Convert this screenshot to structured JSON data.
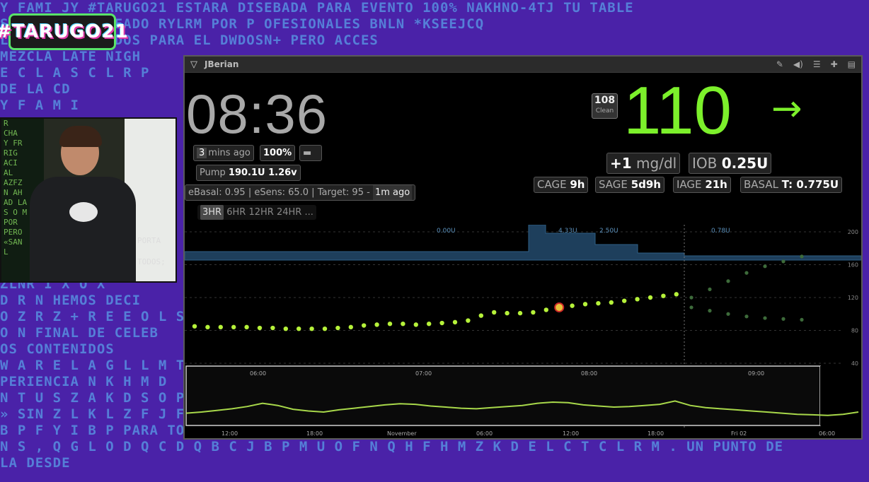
{
  "background": {
    "lines": [
      "Y FAMI   JY #TARUGO21 ESTARA DISEBADA PARA   EVENTO 100% NAKHNO-4TJ  TU TABLE",
      "         S Z X P X  RODEADO RYLRM POR P OFESIONALES BNLN  *KSEEJCQ",
      "     LOS                  ENTRETENIDOS PARA EL DWDOSN+ PERO ACCES",
      "MEZCLA  LATE NIGH",
      "       E  C L A S C L R P",
      "DE LA             CD",
      "Y F A M I",
      "",
      "",
      "",
      "",
      "",
      "",
      "",
      "",
      "",
      "",
      "ZLNR I X O X",
      "D R N  HEMOS DECI",
      "O Z R Z + R E E  O L S A",
      "O N FINAL DE CELEB",
      "OS CONTENIDOS",
      "W A R E  L A  G L L M T Y A",
      "PERIENCIA  N K H M D",
      "N T U  S Z A K D S  O P O",
      "» SIN  Z L K L Z F J F E",
      "B P F Y I B P  PARA TODOS, Y LA  B U M B O F B K  F X  MAS PARECIDA A «U  A MEZCLA B C LATE",
      "N S , Q G L  O D Q C D Q        B C J B P M U O F   N Q H F H M Z K  D E L  C T C L R M . UN PUNTO DE",
      "                               LA                                                       DESDE"
    ]
  },
  "logo": {
    "text": "#TARUGO21"
  },
  "webcam": {
    "matrix_text": "R\nCHA\nY FR\nRIG\nACI\nAL\nAZFZ\nN AH\nAD LA\nS O M\nPOR\nPERO\n«SAN\nL",
    "porta_label": "PORTA",
    "todos_label": "TODOS;"
  },
  "nightscout": {
    "title": "JBerian",
    "clock": "08:36",
    "last_reading_minutes": "3",
    "last_reading_suffix": "mins ago",
    "uploader_battery": "100%",
    "pump_label": "Pump",
    "pump_value": "190.1U 1.26v",
    "loop_text": "eBasal: 0.95 | eSens: 65.0 | Target: 95 -",
    "loop_ago": "1m ago",
    "time_ranges": [
      "3HR",
      "6HR",
      "12HR",
      "24HR",
      "..."
    ],
    "raw_bg": "108",
    "raw_label": "Clean",
    "bg_value": "110",
    "direction_arrow": "→",
    "delta_value": "+1",
    "delta_unit": "mg/dl",
    "iob_label": "IOB",
    "iob_value": "0.25U",
    "cage_label": "CAGE",
    "cage_value": "9h",
    "sage_label": "SAGE",
    "sage_value": "5d9h",
    "iage_label": "IAGE",
    "iage_value": "21h",
    "basal_label": "BASAL",
    "basal_value": "T: 0.775U",
    "colors": {
      "bg_green": "#7cf02b",
      "basal_blue": "#2e5f86",
      "trend_line": "#a8d84a"
    }
  },
  "chart_data": [
    {
      "type": "scatter",
      "title": "",
      "x": [
        0,
        1,
        2,
        3,
        4,
        5,
        6,
        7,
        8,
        9,
        10,
        11,
        12,
        13,
        14,
        15,
        16,
        17,
        18,
        19,
        20,
        21,
        22,
        23,
        24,
        25,
        26,
        27,
        28,
        29,
        30,
        31,
        32,
        33,
        34,
        35,
        36,
        37
      ],
      "values": [
        85,
        84,
        84,
        84,
        84,
        83,
        83,
        82,
        82,
        82,
        82,
        83,
        84,
        86,
        87,
        88,
        88,
        87,
        88,
        89,
        90,
        92,
        98,
        102,
        101,
        101,
        102,
        105,
        108,
        110,
        112,
        113,
        114,
        116,
        118,
        120,
        122,
        124
      ],
      "forecast_high": [
        120,
        130,
        140,
        150,
        158,
        164,
        170
      ],
      "forecast_low": [
        108,
        104,
        100,
        97,
        95,
        94,
        93
      ],
      "basal_labels": [
        "0.00U",
        "4.33U",
        "2.50U",
        "0.78U"
      ],
      "y_ticks": [
        200,
        160,
        120,
        80,
        40
      ],
      "ylim": [
        40,
        200
      ],
      "grid": true
    },
    {
      "type": "line",
      "title": "",
      "top_ticks": [
        "06:00",
        "07:00",
        "08:00",
        "09:00"
      ],
      "bottom_ticks": [
        "12:00",
        "18:00",
        "November",
        "06:00",
        "12:00",
        "18:00",
        "Fri 02",
        "06:00"
      ],
      "values": [
        90,
        92,
        95,
        98,
        102,
        108,
        104,
        97,
        94,
        92,
        96,
        99,
        102,
        105,
        107,
        106,
        103,
        101,
        99,
        98,
        100,
        102,
        104,
        108,
        110,
        109,
        105,
        103,
        101,
        102,
        104,
        106,
        112,
        104,
        100,
        98,
        96,
        94,
        92,
        90,
        88,
        87,
        86,
        88,
        92
      ]
    }
  ]
}
